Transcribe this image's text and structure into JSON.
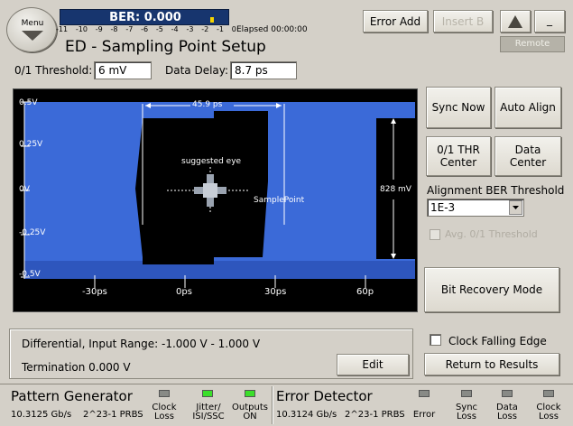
{
  "header": {
    "menu_label": "Menu",
    "ber_label": "BER: 0.000",
    "scale_ticks": [
      "-11",
      "-10",
      "-9",
      "-8",
      "-7",
      "-6",
      "-5",
      "-4",
      "-3",
      "-2",
      "-1",
      "0"
    ],
    "elapsed": "Elapsed 00:00:00",
    "title": "ED - Sampling Point Setup",
    "error_add": "Error Add",
    "insert_b": "Insert B",
    "minimize": "_",
    "remote": "Remote"
  },
  "params": {
    "threshold_label": "0/1 Threshold:",
    "threshold_value": "6 mV",
    "delay_label": "Data Delay:",
    "delay_value": "8.7 ps"
  },
  "eye": {
    "y_ticks": [
      "0.5V",
      "0.25V",
      "0V",
      "-0.25V",
      "-0.5V"
    ],
    "x_ticks": [
      "-30ps",
      "0ps",
      "30ps",
      "60p"
    ],
    "width_measure": "45.9 ps",
    "height_measure": "828 mV",
    "suggested": "suggested eye",
    "sample_point": "SamplePoint"
  },
  "controls": {
    "sync_now": "Sync Now",
    "auto_align": "Auto Align",
    "thr_center": "0/1 THR Center",
    "data_center": "Data Center",
    "alignment_label": "Alignment  BER Threshold",
    "ber_threshold": "1E-3",
    "avg_threshold": "Avg. 0/1 Threshold",
    "bit_recovery": "Bit Recovery Mode"
  },
  "info": {
    "input_range": "Differential, Input Range: -1.000 V - 1.000 V",
    "termination": "Termination 0.000 V",
    "edit": "Edit",
    "clock_falling": "Clock Falling Edge",
    "return_results": "Return to Results"
  },
  "status": {
    "pg_title": "Pattern Generator",
    "pg_rate": "10.3125 Gb/s",
    "pg_pattern": "2^23-1 PRBS",
    "pg_clock_loss": "Clock Loss",
    "pg_jitter": "Jitter/ ISI/SSC",
    "pg_outputs": "Outputs ON",
    "ed_title": "Error Detector",
    "ed_rate": "10.3124 Gb/s",
    "ed_pattern": "2^23-1 PRBS",
    "ed_error": "Error",
    "ed_sync_loss": "Sync Loss",
    "ed_data_loss": "Data Loss",
    "ed_clock_loss": "Clock Loss"
  }
}
